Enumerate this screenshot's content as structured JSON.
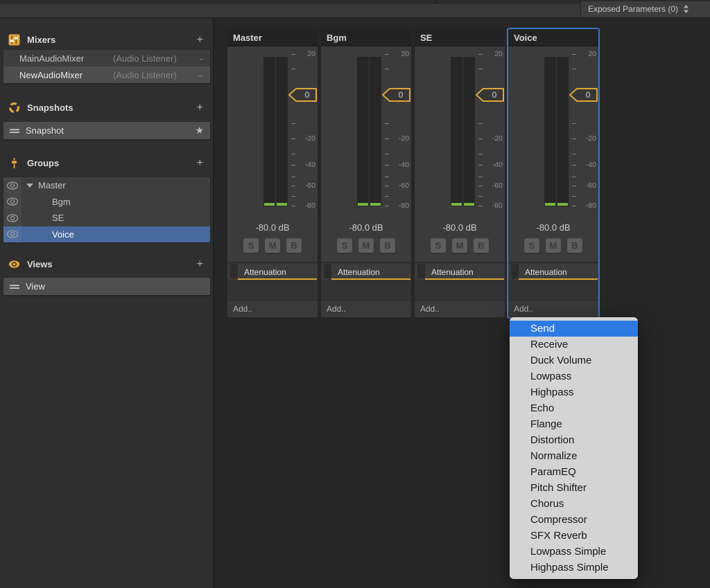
{
  "toolbar": {
    "exposed_parameters": "Exposed Parameters (0)"
  },
  "sidebar": {
    "sections": {
      "mixers": {
        "title": "Mixers",
        "add_label": "+"
      },
      "snapshots": {
        "title": "Snapshots",
        "add_label": "+"
      },
      "groups": {
        "title": "Groups",
        "add_label": "+"
      },
      "views": {
        "title": "Views",
        "add_label": "+"
      }
    },
    "mixers_list": [
      {
        "name": "MainAudioMixer",
        "type": "(Audio Listener)",
        "suffix": "-",
        "active": false
      },
      {
        "name": "NewAudioMixer",
        "type": "(Audio Listener)",
        "suffix": "–",
        "active": true
      }
    ],
    "snapshots_list": [
      {
        "name": "Snapshot",
        "starred": true,
        "star_glyph": "★"
      }
    ],
    "groups_list": [
      {
        "name": "Master",
        "level": 0,
        "expanded": true,
        "selected": false
      },
      {
        "name": "Bgm",
        "level": 1,
        "selected": false
      },
      {
        "name": "SE",
        "level": 1,
        "selected": false
      },
      {
        "name": "Voice",
        "level": 1,
        "selected": true
      }
    ],
    "views_list": [
      {
        "name": "View"
      }
    ]
  },
  "strips": {
    "channels": [
      {
        "title": "Master",
        "selected": false
      },
      {
        "title": "Bgm",
        "selected": false
      },
      {
        "title": "SE",
        "selected": false
      },
      {
        "title": "Voice",
        "selected": true
      }
    ],
    "volume_label": "-80.0 dB",
    "fader_value": "0",
    "fader_db": 0,
    "buttons": [
      "S",
      "M",
      "B"
    ],
    "effects": [
      {
        "name": "Attenuation",
        "color": "#DFA637"
      }
    ],
    "add_label": "Add..",
    "meter_ticks": [
      {
        "db": 20,
        "label": "20",
        "t": 0.0
      },
      {
        "db": 10,
        "label": "",
        "t": 0.096
      },
      {
        "db": 0,
        "label": "",
        "t": 0.269
      },
      {
        "db": -10,
        "label": "",
        "t": 0.457
      },
      {
        "db": -20,
        "label": "-20",
        "t": 0.557
      },
      {
        "db": -30,
        "label": "",
        "t": 0.658
      },
      {
        "db": -40,
        "label": "-40",
        "t": 0.731
      },
      {
        "db": -50,
        "label": "",
        "t": 0.808
      },
      {
        "db": -60,
        "label": "-60",
        "t": 0.868
      },
      {
        "db": -70,
        "label": "",
        "t": 0.936
      },
      {
        "db": -80,
        "label": "-80",
        "t": 1.0
      }
    ]
  },
  "context_menu": {
    "items": [
      "Send",
      "Receive",
      "Duck Volume",
      "Lowpass",
      "Highpass",
      "Echo",
      "Flange",
      "Distortion",
      "Normalize",
      "ParamEQ",
      "Pitch Shifter",
      "Chorus",
      "Compressor",
      "SFX Reverb",
      "Lowpass Simple",
      "Highpass Simple"
    ],
    "selected_index": 0
  },
  "colors": {
    "accent_orange": "#E2A63D",
    "selection_blue": "#48699C",
    "menu_highlight_blue": "#2E7AE3",
    "strip_selected_border": "#3D74C6",
    "meter_green": "#76B83E"
  }
}
